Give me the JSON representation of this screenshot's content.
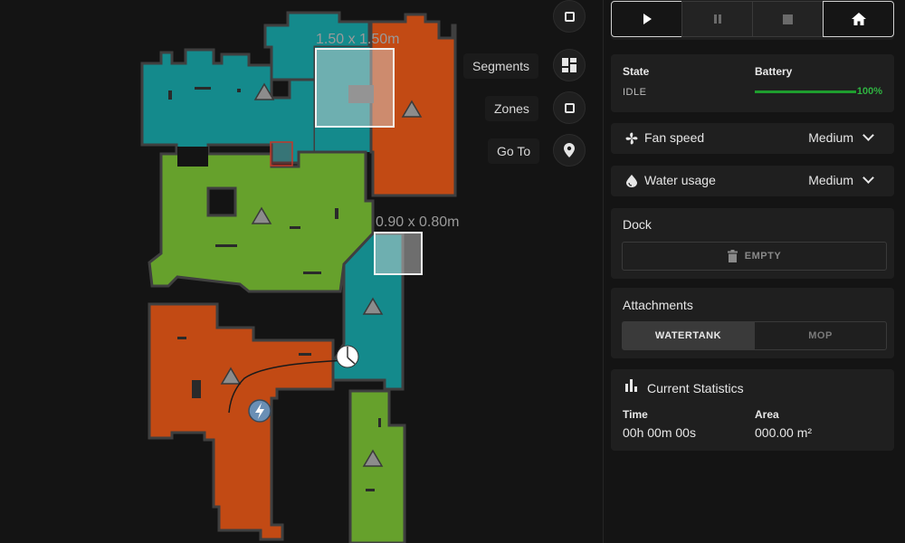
{
  "map": {
    "zone_labels": [
      "1.50 x 1.50m",
      "0.90 x 0.80m"
    ],
    "colors": {
      "teal": "#148a8c",
      "orange": "#c24a14",
      "green": "#66a12c",
      "wall": "#3f3f3f",
      "bg": "#141414"
    },
    "controls": [
      {
        "label": "",
        "icon": "square-icon"
      },
      {
        "label": "Segments",
        "icon": "grid-icon"
      },
      {
        "label": "Zones",
        "icon": "square-outline-icon"
      },
      {
        "label": "Go To",
        "icon": "location-pin-icon"
      }
    ]
  },
  "robot_controls": {
    "buttons": [
      {
        "name": "start",
        "icon": "play-icon",
        "active": true
      },
      {
        "name": "pause",
        "icon": "pause-icon",
        "active": false
      },
      {
        "name": "stop",
        "icon": "stop-icon",
        "active": false
      },
      {
        "name": "home",
        "icon": "home-icon",
        "active": true
      }
    ]
  },
  "status": {
    "state_label": "State",
    "state_value": "IDLE",
    "battery_label": "Battery",
    "battery_value": "100%",
    "battery_level": 1.0,
    "battery_color": "#1e9e2e"
  },
  "fan_speed": {
    "label": "Fan speed",
    "value": "Medium",
    "icon": "fan-icon"
  },
  "water_usage": {
    "label": "Water usage",
    "value": "Medium",
    "icon": "water-drop-icon"
  },
  "dock": {
    "title": "Dock",
    "button": "EMPTY",
    "icon": "trash-icon"
  },
  "attachments": {
    "title": "Attachments",
    "options": [
      "WATERTANK",
      "MOP"
    ],
    "selected": "WATERTANK"
  },
  "statistics": {
    "title": "Current Statistics",
    "icon": "bar-chart-icon",
    "time_label": "Time",
    "time_value": "00h 00m 00s",
    "area_label": "Area",
    "area_value": "000.00 m²"
  }
}
